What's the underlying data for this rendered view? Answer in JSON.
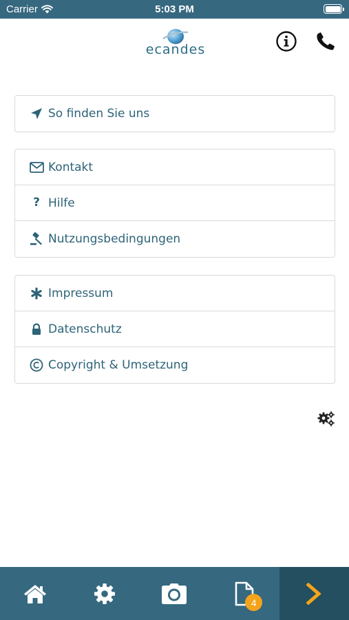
{
  "status_bar": {
    "carrier": "Carrier",
    "time": "5:03 PM"
  },
  "header": {
    "logo_text": "ecandes",
    "info_icon": "info-icon",
    "phone_icon": "phone-icon"
  },
  "menu_groups": [
    {
      "items": [
        {
          "label": "So finden Sie uns",
          "icon": "location-arrow-icon"
        }
      ]
    },
    {
      "items": [
        {
          "label": "Kontakt",
          "icon": "envelope-icon"
        },
        {
          "label": "Hilfe",
          "icon": "question-icon"
        },
        {
          "label": "Nutzungsbedingungen",
          "icon": "gavel-icon"
        }
      ]
    },
    {
      "items": [
        {
          "label": "Impressum",
          "icon": "asterisk-icon"
        },
        {
          "label": "Datenschutz",
          "icon": "lock-icon"
        },
        {
          "label": "Copyright & Umsetzung",
          "icon": "copyright-icon"
        }
      ]
    }
  ],
  "settings_icon": "gears-icon",
  "tab_bar": {
    "tabs": [
      {
        "icon": "home-icon"
      },
      {
        "icon": "settings-icon"
      },
      {
        "icon": "camera-icon"
      },
      {
        "icon": "document-icon",
        "badge": "4"
      },
      {
        "icon": "chevron-right-icon"
      }
    ]
  },
  "colors": {
    "bar": "#36687f",
    "bar_active": "#234f60",
    "text": "#2d6377",
    "accent": "#f4a41b"
  }
}
